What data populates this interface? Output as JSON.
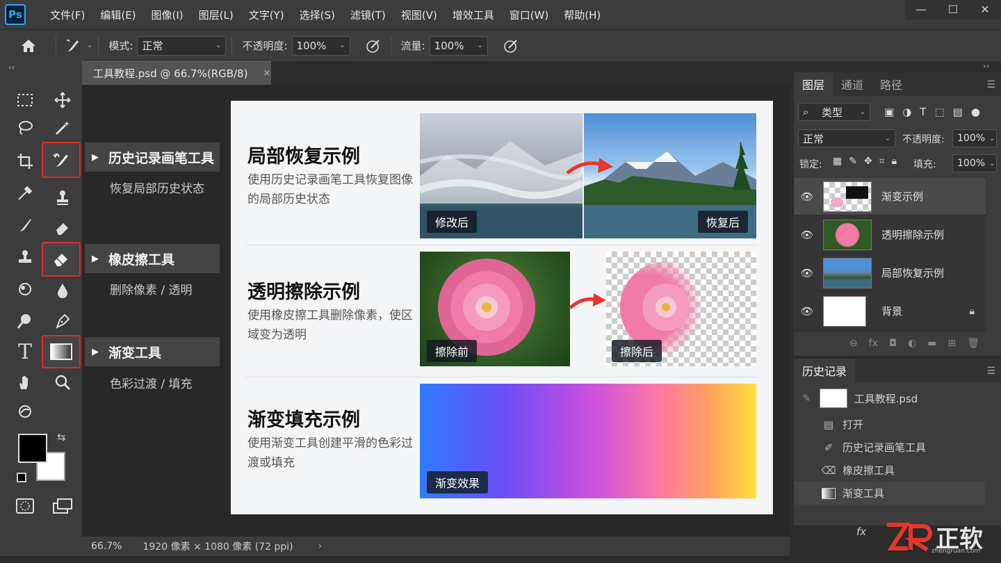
{
  "app": {
    "logo": "Ps"
  },
  "menu": [
    "文件(F)",
    "编辑(E)",
    "图像(I)",
    "图层(L)",
    "文字(Y)",
    "选择(S)",
    "滤镜(T)",
    "视图(V)",
    "增效工具",
    "窗口(W)",
    "帮助(H)"
  ],
  "window_controls": {
    "minimize": "—",
    "maximize": "☐",
    "close": "✕"
  },
  "options": {
    "mode_label": "模式:",
    "mode_value": "正常",
    "opacity_label": "不透明度:",
    "opacity_value": "100%",
    "flow_label": "流量:",
    "flow_value": "100%"
  },
  "collapse_left": "‹‹",
  "collapse_right": "››",
  "doc_tab": {
    "title": "工具教程.psd @ 66.7%(RGB/8)",
    "close": "×"
  },
  "flyouts": [
    {
      "title": "历史记录画笔工具",
      "desc": "恢复局部历史状态"
    },
    {
      "title": "橡皮擦工具",
      "desc": "删除像素 / 透明"
    },
    {
      "title": "渐变工具",
      "desc": "色彩过渡 / 填充"
    }
  ],
  "canvas": {
    "row1": {
      "title": "局部恢复示例",
      "desc": "使用历史记录画笔工具恢复图像的局部历史状态",
      "tag_left": "修改后",
      "tag_right": "恢复后"
    },
    "row2": {
      "title": "透明擦除示例",
      "desc": "使用橡皮擦工具删除像素，使区域变为透明",
      "tag_left": "擦除前",
      "tag_right": "擦除后"
    },
    "row3": {
      "title": "渐变填充示例",
      "desc": "使用渐变工具创建平滑的色彩过渡或填充",
      "tag": "渐变效果"
    }
  },
  "status": {
    "zoom": "66.7%",
    "size": "1920 像素 × 1080 像素 (72 ppi)",
    "arrow": "›"
  },
  "layers_panel": {
    "tabs": [
      "图层",
      "通道",
      "路径"
    ],
    "filter": "类型",
    "blend": "正常",
    "opacity_label": "不透明度:",
    "opacity": "100%",
    "lock_label": "锁定:",
    "fill_label": "填充:",
    "fill": "100%",
    "layers": [
      {
        "name": "渐变示例"
      },
      {
        "name": "透明擦除示例"
      },
      {
        "name": "局部恢复示例"
      },
      {
        "name": "背景"
      }
    ]
  },
  "history_panel": {
    "title": "历史记录",
    "snapshot": "工具教程.psd",
    "items": [
      "打开",
      "历史记录画笔工具",
      "橡皮擦工具",
      "渐变工具"
    ]
  },
  "watermark": {
    "text": "正软",
    "domain": "zhengruan.com"
  },
  "colors": {
    "accent_red": "#e0292b",
    "panel": "#3c3c3c",
    "canvas_bg": "#282828"
  }
}
